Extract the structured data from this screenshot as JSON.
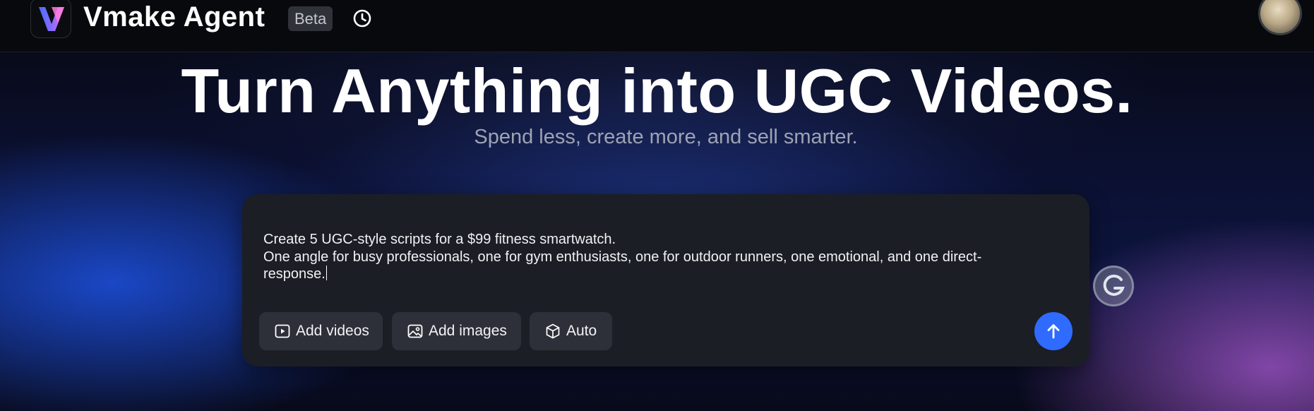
{
  "header": {
    "app_title": "Vmake Agent",
    "badge": "Beta",
    "logo_icon": "vmake-logo-icon",
    "history_icon": "history-clock-icon",
    "avatar_icon": "user-avatar"
  },
  "hero": {
    "title": "Turn Anything into UGC Videos.",
    "subtitle": "Spend less, create more, and sell smarter."
  },
  "composer": {
    "prompt_lines": [
      "Create 5 UGC-style scripts for a $99 fitness smartwatch.",
      "One angle for busy professionals, one for gym enthusiasts, one for outdoor runners, one emotional, and one direct-",
      "response."
    ],
    "buttons": {
      "add_videos": "Add videos",
      "add_images": "Add images",
      "auto": "Auto"
    },
    "send_icon": "arrow-up-icon"
  },
  "colors": {
    "accent": "#2f6bff",
    "header_bg": "#08090c",
    "composer_bg": "#1c1e25",
    "chip_bg": "#2d3038"
  }
}
